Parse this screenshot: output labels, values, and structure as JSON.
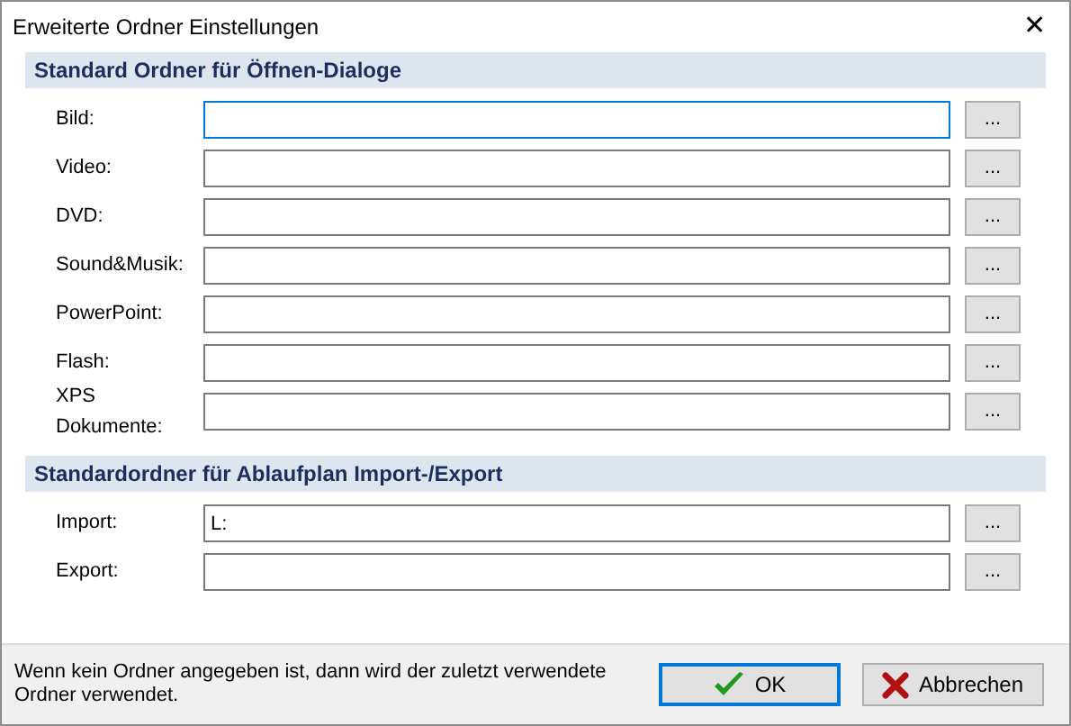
{
  "window": {
    "title": "Erweiterte Ordner Einstellungen",
    "close": "✕"
  },
  "sections": [
    {
      "title": "Standard Ordner für Öffnen-Dialoge",
      "rows": [
        {
          "label": "Bild:",
          "value": "",
          "focused": true,
          "browse": "..."
        },
        {
          "label": "Video:",
          "value": "",
          "focused": false,
          "browse": "..."
        },
        {
          "label": "DVD:",
          "value": "",
          "focused": false,
          "browse": "..."
        },
        {
          "label": "Sound&Musik:",
          "value": "",
          "focused": false,
          "browse": "..."
        },
        {
          "label": "PowerPoint:",
          "value": "",
          "focused": false,
          "browse": "..."
        },
        {
          "label": "Flash:",
          "value": "",
          "focused": false,
          "browse": "..."
        },
        {
          "label": "XPS Dokumente:",
          "value": "",
          "focused": false,
          "browse": "..."
        }
      ]
    },
    {
      "title": "Standardordner für Ablaufplan Import-/Export",
      "rows": [
        {
          "label": "Import:",
          "value": "L:",
          "focused": false,
          "browse": "..."
        },
        {
          "label": "Export:",
          "value": "",
          "focused": false,
          "browse": "..."
        }
      ]
    }
  ],
  "footer": {
    "note": "Wenn kein Ordner angegeben ist, dann wird der zuletzt verwendete Ordner verwendet.",
    "buttons": [
      {
        "label": "OK",
        "kind": "ok",
        "default": true
      },
      {
        "label": "Abbrechen",
        "kind": "cancel",
        "default": false
      }
    ]
  }
}
